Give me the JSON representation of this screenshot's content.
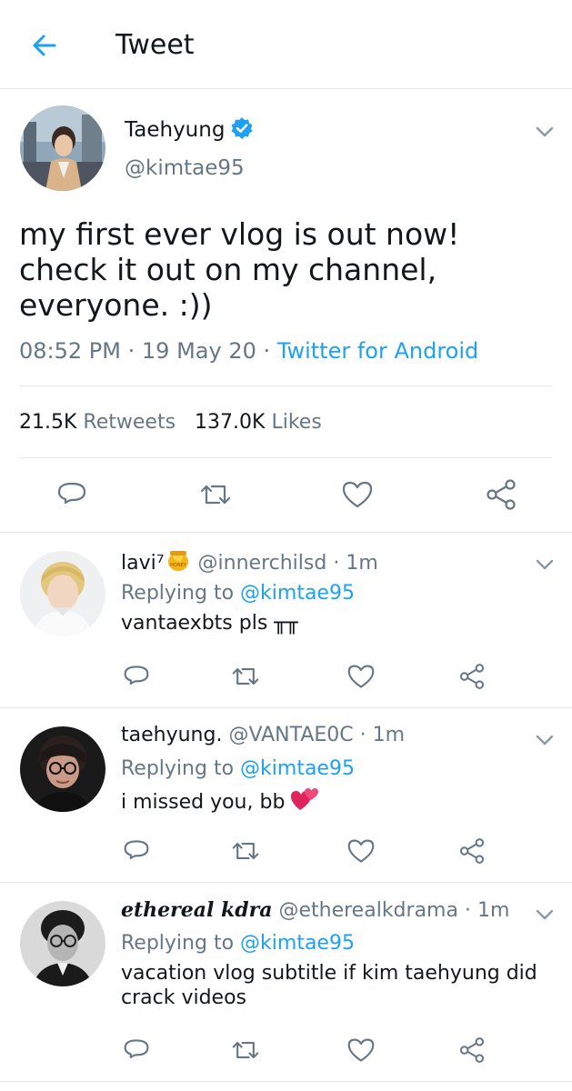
{
  "header": {
    "title": "Tweet",
    "back_icon": "arrow-left-icon",
    "accent": "#1da1f2"
  },
  "tweet": {
    "author_name": "Taehyung",
    "author_handle": "@kimtae95",
    "verified": true,
    "text": "my first ever vlog is out now!\ncheck it out on my channel,\neveryone. :))",
    "time": "08:52 PM",
    "date": "19 May 20",
    "source": "Twitter for Android",
    "retweet_count": "21.5K",
    "retweet_label": "Retweets",
    "like_count": "137.0K",
    "like_label": "Likes"
  },
  "actions": [
    "reply-icon",
    "retweet-icon",
    "like-icon",
    "share-icon"
  ],
  "replies": [
    {
      "name": "lavi⁷",
      "name_emoji": "honey-pot-icon",
      "handle": "@innerchilsd",
      "time": "1m",
      "replying_prefix": "Replying to",
      "replying_handle": "@kimtae95",
      "text": "vantaexbts pls ╥╥"
    },
    {
      "name": "taehyung.",
      "handle": "@VANTAE0C",
      "time": "1m",
      "replying_prefix": "Replying to",
      "replying_handle": "@kimtae95",
      "text": "i missed you, bb",
      "text_emoji": "two-hearts-icon"
    },
    {
      "name": "ethereal kdra",
      "handle": "@etherealkdrama",
      "time": "1m",
      "replying_prefix": "Replying to",
      "replying_handle": "@kimtae95",
      "text": "vacation vlog subtitle if kim taehyung did crack videos"
    }
  ],
  "separator": "·"
}
